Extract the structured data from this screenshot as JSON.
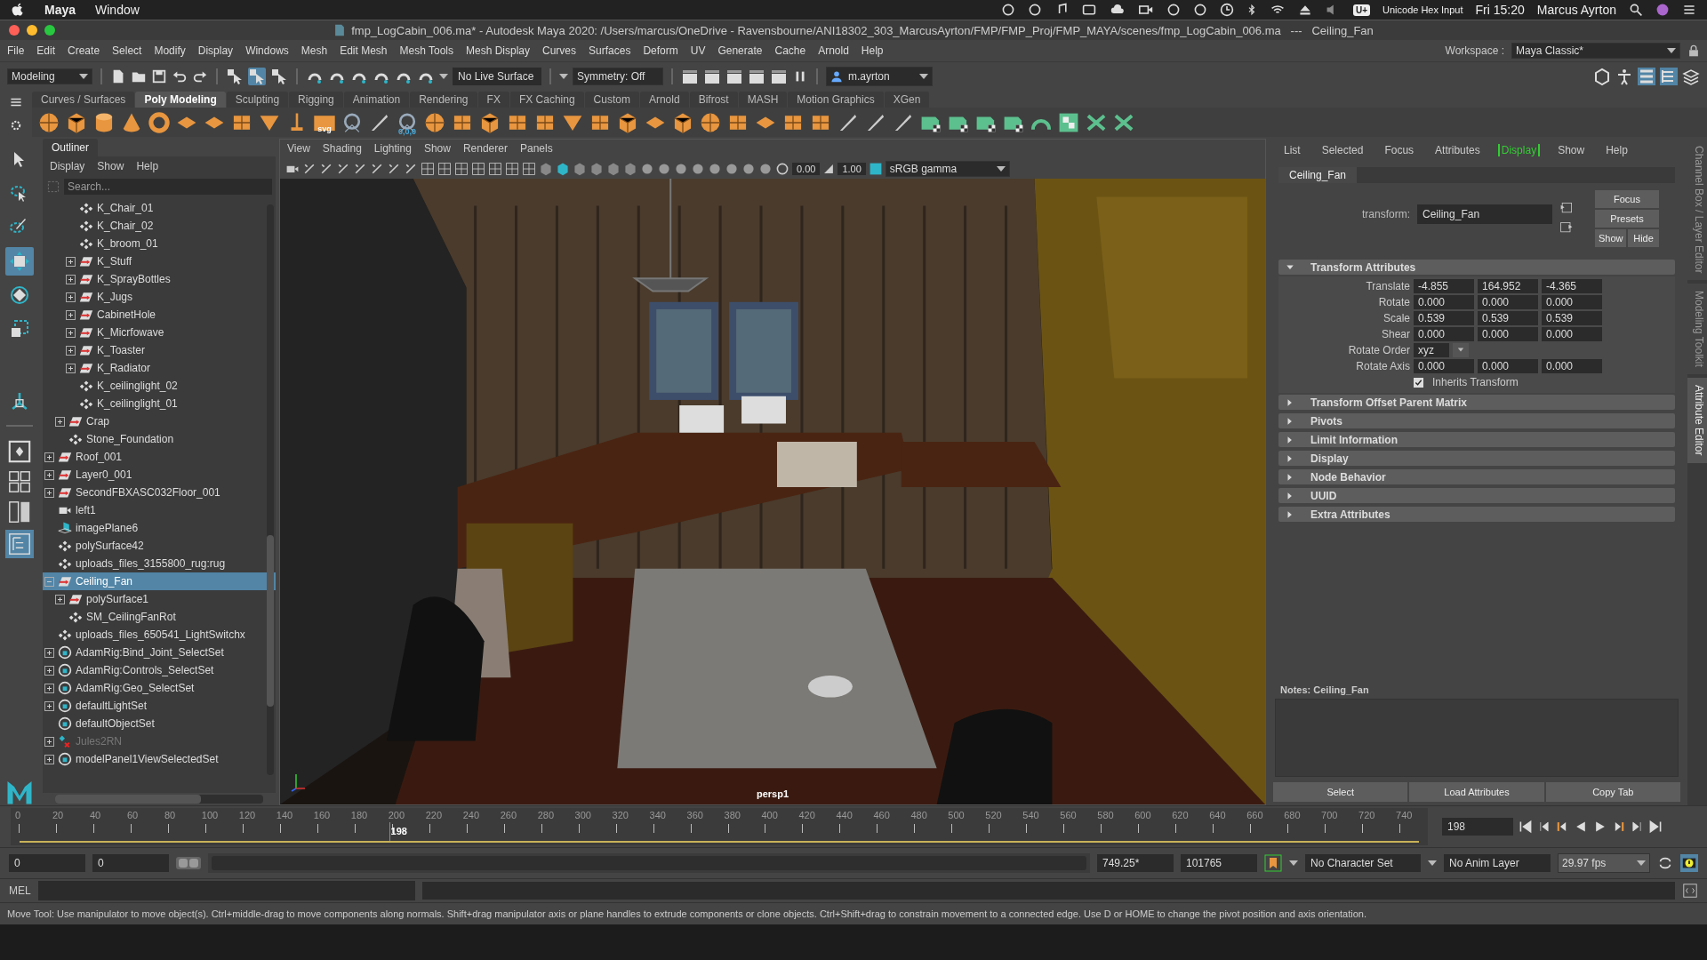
{
  "mac_menubar": {
    "app_name": "Maya",
    "menus": [
      "Window"
    ],
    "input_badge": "U+",
    "input_source": "Unicode Hex Input",
    "clock": "Fri 15:20",
    "user": "Marcus Ayrton"
  },
  "window": {
    "title": "fmp_LogCabin_006.ma* - Autodesk Maya 2020: /Users/marcus/OneDrive - Ravensbourne/ANI18302_303_MarcusAyrton/FMP/FMP_Proj/FMP_MAYA/scenes/fmp_LogCabin_006.ma   ---   Ceiling_Fan"
  },
  "menus": [
    "File",
    "Edit",
    "Create",
    "Select",
    "Modify",
    "Display",
    "Windows",
    "Mesh",
    "Edit Mesh",
    "Mesh Tools",
    "Mesh Display",
    "Curves",
    "Surfaces",
    "Deform",
    "UV",
    "Generate",
    "Cache",
    "Arnold",
    "Help"
  ],
  "workspace": {
    "label": "Workspace :",
    "value": "Maya Classic*"
  },
  "status_line": {
    "menu_set": "Modeling",
    "live_surface": "No Live Surface",
    "symmetry": "Symmetry: Off",
    "user": "m.ayrton"
  },
  "shelf_tabs": [
    {
      "label": "Curves / Surfaces",
      "selected": false
    },
    {
      "label": "Poly Modeling",
      "selected": true
    },
    {
      "label": "Sculpting",
      "selected": false
    },
    {
      "label": "Rigging",
      "selected": false
    },
    {
      "label": "Animation",
      "selected": false
    },
    {
      "label": "Rendering",
      "selected": false
    },
    {
      "label": "FX",
      "selected": false
    },
    {
      "label": "FX Caching",
      "selected": false
    },
    {
      "label": "Custom",
      "selected": false
    },
    {
      "label": "Arnold",
      "selected": false
    },
    {
      "label": "Bifrost",
      "selected": false
    },
    {
      "label": "MASH",
      "selected": false
    },
    {
      "label": "Motion Graphics",
      "selected": false
    },
    {
      "label": "XGen",
      "selected": false
    }
  ],
  "shelf_icon_texts": [
    "svg",
    "0,0,0"
  ],
  "toolbox": [
    {
      "kind": "select",
      "selected": false
    },
    {
      "kind": "lasso",
      "selected": false
    },
    {
      "kind": "paint",
      "selected": false
    },
    {
      "kind": "move",
      "selected": true
    },
    {
      "kind": "rotate",
      "selected": false
    },
    {
      "kind": "scale",
      "selected": false
    }
  ],
  "outliner": {
    "title": "Outliner",
    "menus": [
      "Display",
      "Show",
      "Help"
    ],
    "search_placeholder": "Search...",
    "items": [
      {
        "children": [
          {
            "children": [
              {
                "label": "K_Chair_01",
                "kind": "mesh",
                "selected": false,
                "disabled": false
              },
              {
                "label": "K_Chair_02",
                "kind": "mesh",
                "selected": false,
                "disabled": false
              },
              {
                "label": "K_broom_01",
                "kind": "mesh",
                "selected": false,
                "disabled": false
              },
              {
                "label": "K_Stuff",
                "kind": "group",
                "expanded": false,
                "selected": false,
                "disabled": false
              },
              {
                "label": "K_SprayBottles",
                "kind": "group",
                "expanded": false,
                "selected": false,
                "disabled": false
              },
              {
                "label": "K_Jugs",
                "kind": "group",
                "expanded": false,
                "selected": false,
                "disabled": false
              },
              {
                "label": "CabinetHole",
                "kind": "group",
                "expanded": false,
                "selected": false,
                "disabled": false
              },
              {
                "label": "K_Micrfowave",
                "kind": "group",
                "expanded": false,
                "selected": false,
                "disabled": false
              },
              {
                "label": "K_Toaster",
                "kind": "group",
                "expanded": false,
                "selected": false,
                "disabled": false
              },
              {
                "label": "K_Radiator",
                "kind": "group",
                "expanded": false,
                "selected": false,
                "disabled": false
              },
              {
                "label": "K_ceilinglight_02",
                "kind": "mesh",
                "selected": false,
                "disabled": false
              },
              {
                "label": "K_ceilinglight_01",
                "kind": "mesh",
                "selected": false,
                "disabled": false
              }
            ]
          },
          {
            "label": "Crap",
            "kind": "group",
            "expanded": false,
            "selected": false,
            "disabled": false
          },
          {
            "label": "Stone_Foundation",
            "kind": "mesh",
            "selected": false,
            "disabled": false
          }
        ]
      },
      {
        "label": "Roof_001",
        "kind": "group",
        "expanded": false,
        "selected": false,
        "disabled": false
      },
      {
        "label": "Layer0_001",
        "kind": "group",
        "expanded": false,
        "selected": false,
        "disabled": false
      },
      {
        "label": "SecondFBXASC032Floor_001",
        "kind": "group",
        "expanded": false,
        "selected": false,
        "disabled": false
      },
      {
        "label": "left1",
        "kind": "camera",
        "selected": false,
        "disabled": false
      },
      {
        "label": "imagePlane6",
        "kind": "image_plane",
        "selected": false,
        "disabled": false
      },
      {
        "label": "polySurface42",
        "kind": "mesh",
        "selected": false,
        "disabled": false
      },
      {
        "label": "uploads_files_3155800_rug:rug",
        "kind": "mesh",
        "selected": false,
        "disabled": false
      },
      {
        "label": "Ceiling_Fan",
        "kind": "group",
        "expanded": true,
        "selected": true,
        "disabled": false,
        "children": [
          {
            "label": "polySurface1",
            "kind": "group",
            "expanded": false,
            "selected": false,
            "disabled": false
          },
          {
            "label": "SM_CeilingFanRot",
            "kind": "mesh",
            "selected": false,
            "disabled": false
          }
        ]
      },
      {
        "label": "uploads_files_650541_LightSwitchx",
        "kind": "mesh",
        "selected": false,
        "disabled": false
      },
      {
        "label": "AdamRig:Bind_Joint_SelectSet",
        "kind": "set",
        "expanded": false,
        "selected": false,
        "disabled": false
      },
      {
        "label": "AdamRig:Controls_SelectSet",
        "kind": "set",
        "expanded": false,
        "selected": false,
        "disabled": false
      },
      {
        "label": "AdamRig:Geo_SelectSet",
        "kind": "set",
        "expanded": false,
        "selected": false,
        "disabled": false
      },
      {
        "label": "defaultLightSet",
        "kind": "set",
        "expanded": false,
        "selected": false,
        "disabled": false
      },
      {
        "label": "defaultObjectSet",
        "kind": "set",
        "selected": false,
        "disabled": false
      },
      {
        "label": "Jules2RN",
        "kind": "reference",
        "expanded": false,
        "selected": false,
        "disabled": true
      },
      {
        "label": "modelPanel1ViewSelectedSet",
        "kind": "set",
        "expanded": false,
        "selected": false,
        "disabled": false
      }
    ]
  },
  "viewport": {
    "menus": [
      "View",
      "Shading",
      "Lighting",
      "Show",
      "Renderer",
      "Panels"
    ],
    "exposure": "0.00",
    "gamma": "1.00",
    "color_space": "sRGB gamma",
    "camera": "persp1"
  },
  "attribute_editor": {
    "menus": [
      {
        "label": "List",
        "selected": false
      },
      {
        "label": "Selected",
        "selected": false
      },
      {
        "label": "Focus",
        "selected": false
      },
      {
        "label": "Attributes",
        "selected": false
      },
      {
        "label": "Display",
        "selected": true
      },
      {
        "label": "Show",
        "selected": false
      },
      {
        "label": "Help",
        "selected": false
      }
    ],
    "tab": "Ceiling_Fan",
    "node_type": "transform:",
    "node_name": "Ceiling_Fan",
    "buttons": [
      "Focus",
      "Presets",
      "Show",
      "Hide"
    ],
    "sections": [
      {
        "title": "Transform Attributes",
        "expanded": true,
        "rows": [
          {
            "kind": "vector",
            "label": "Translate",
            "values": [
              "-4.855",
              "164.952",
              "-4.365"
            ]
          },
          {
            "kind": "vector",
            "label": "Rotate",
            "values": [
              "0.000",
              "0.000",
              "0.000"
            ]
          },
          {
            "kind": "vector",
            "label": "Scale",
            "values": [
              "0.539",
              "0.539",
              "0.539"
            ]
          },
          {
            "kind": "vector",
            "label": "Shear",
            "values": [
              "0.000",
              "0.000",
              "0.000"
            ]
          },
          {
            "kind": "dropdown",
            "label": "Rotate Order",
            "value": "xyz"
          },
          {
            "kind": "vector",
            "label": "Rotate Axis",
            "values": [
              "0.000",
              "0.000",
              "0.000"
            ]
          },
          {
            "kind": "checkbox",
            "label": "Inherits Transform",
            "checked": true
          }
        ]
      },
      {
        "title": "Transform Offset Parent Matrix",
        "expanded": false
      },
      {
        "title": "Pivots",
        "expanded": false
      },
      {
        "title": "Limit Information",
        "expanded": false
      },
      {
        "title": "Display",
        "expanded": false
      },
      {
        "title": "Node Behavior",
        "expanded": false
      },
      {
        "title": "UUID",
        "expanded": false
      },
      {
        "title": "Extra Attributes",
        "expanded": false
      }
    ],
    "notes_label": "Notes:  Ceiling_Fan",
    "bottom_buttons": [
      "Select",
      "Load Attributes",
      "Copy Tab"
    ]
  },
  "side_tabs": [
    {
      "label": "Channel Box / Layer Editor",
      "selected": false
    },
    {
      "label": "Modeling Toolkit",
      "selected": false
    },
    {
      "label": "Attribute Editor",
      "selected": true
    }
  ],
  "timeline": {
    "ticks": [
      "0",
      "20",
      "40",
      "60",
      "80",
      "100",
      "120",
      "140",
      "160",
      "180",
      "200",
      "220",
      "240",
      "260",
      "280",
      "300",
      "320",
      "340",
      "360",
      "380",
      "400",
      "420",
      "440",
      "460",
      "480",
      "500",
      "520",
      "540",
      "560",
      "580",
      "600",
      "620",
      "640",
      "660",
      "680",
      "700",
      "720",
      "740"
    ],
    "playhead": {
      "label": "198",
      "level": 0.264
    },
    "current_frame": "198"
  },
  "range": {
    "level": 1,
    "start": "0",
    "range_start": "0",
    "range_end": "749.25*",
    "end": "101765",
    "character_set": "No Character Set",
    "anim_layer": "No Anim Layer",
    "fps": "29.97 fps"
  },
  "command_line": {
    "language": "MEL"
  },
  "help_line": "Move Tool: Use manipulator to move object(s). Ctrl+middle-drag to move components along normals. Shift+drag manipulator axis or plane handles to extrude components or clone objects. Ctrl+Shift+drag to constrain movement to a connected edge. Use D or HOME to change the pivot position and axis orientation."
}
